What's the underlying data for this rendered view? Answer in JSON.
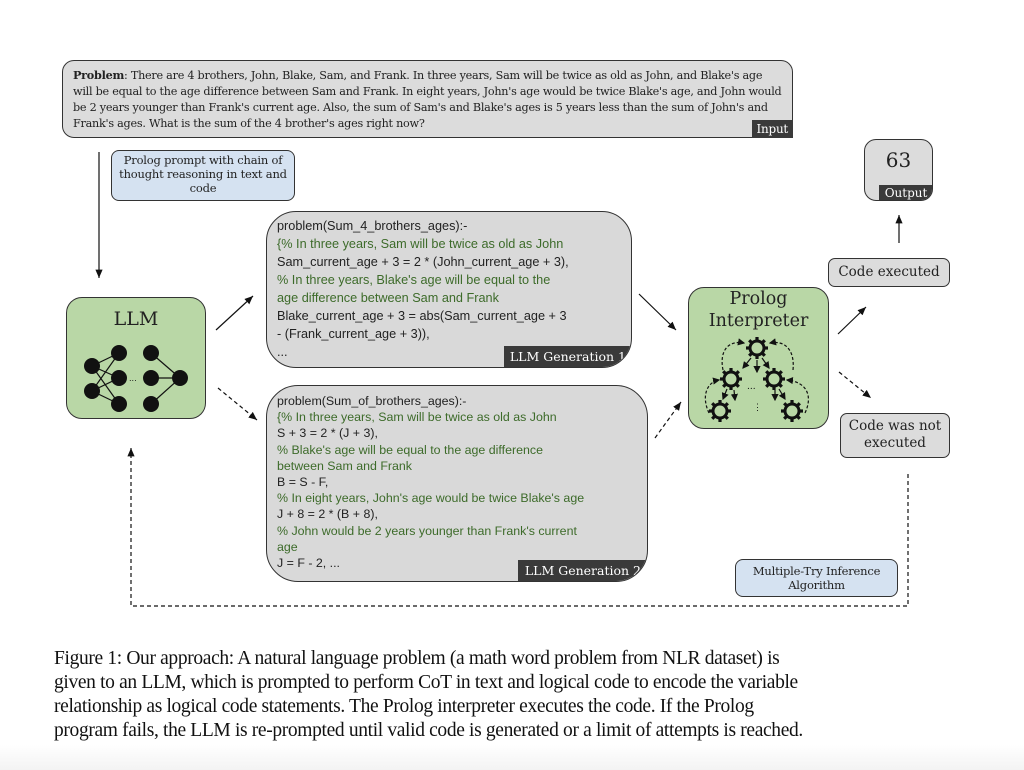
{
  "figure": {
    "input": {
      "problem_label": "Problem",
      "problem_text": ": There are 4 brothers, John, Blake, Sam, and Frank. In three years, Sam will be twice as old as John, and Blake's age will be equal to the age difference between Sam and Frank. In eight years, John's age would be twice Blake's age, and John would be 2 years younger than Frank's current age. Also, the sum of Sam's and Blake's ages is 5 years less than the sum of John's and Frank's ages. What is the sum of the 4 brother's ages right now?",
      "tag": "Input"
    },
    "prompt_box": {
      "text": "Prolog prompt with chain of thought reasoning in text and code"
    },
    "llm": {
      "title": "LLM",
      "icon": "neural-network-icon"
    },
    "generation_1": {
      "tag": "LLM Generation 1",
      "lines": [
        {
          "type": "code",
          "text": "problem(Sum_4_brothers_ages):-"
        },
        {
          "type": "comment",
          "text": "{% In three years, Sam will be twice as old as John"
        },
        {
          "type": "code",
          "text": "Sam_current_age + 3 = 2 * (John_current_age + 3),"
        },
        {
          "type": "comment",
          "text": "% In three years, Blake's age will be equal to the"
        },
        {
          "type": "comment",
          "text": "age difference between Sam and Frank"
        },
        {
          "type": "code",
          "text": "Blake_current_age + 3 = abs(Sam_current_age + 3"
        },
        {
          "type": "code",
          "text": "- (Frank_current_age + 3)),"
        },
        {
          "type": "code",
          "text": "..."
        }
      ]
    },
    "generation_2": {
      "tag": "LLM Generation 2",
      "lines": [
        {
          "type": "code",
          "text": "problem(Sum_of_brothers_ages):-"
        },
        {
          "type": "comment",
          "text": "{% In three years, Sam will be twice as old as John"
        },
        {
          "type": "code",
          "text": "S + 3 = 2 * (J + 3),"
        },
        {
          "type": "comment",
          "text": "% Blake's age will be equal to the age difference"
        },
        {
          "type": "comment",
          "text": "between Sam and Frank"
        },
        {
          "type": "code",
          "text": "B = S - F,"
        },
        {
          "type": "comment",
          "text": "% In eight years, John's age would be twice Blake's age"
        },
        {
          "type": "code",
          "text": "J + 8 = 2 * (B + 8),"
        },
        {
          "type": "comment",
          "text": "% John would be 2 years younger than Frank's current"
        },
        {
          "type": "comment",
          "text": "age"
        },
        {
          "type": "code",
          "text": "J = F - 2, ..."
        }
      ]
    },
    "interpreter": {
      "title_line1": "Prolog",
      "title_line2": "Interpreter",
      "icon": "gears-tree-icon"
    },
    "output": {
      "value": "63",
      "tag": "Output"
    },
    "code_executed": "Code executed",
    "code_not_executed": "Code was not executed",
    "multi_try": "Multiple-Try Inference Algorithm",
    "colors": {
      "green_box": "#b9d7a6",
      "blue_box": "#d5e2f1",
      "gray_box": "#d9d9d9",
      "tag_bg": "#3a3a3a",
      "comment_text": "#3d6b2a"
    }
  },
  "caption": {
    "lines": [
      "Figure 1: Our approach: A natural language problem (a math word problem from NLR dataset) is",
      "given to an LLM, which is prompted to perform CoT in text and logical code to encode the variable",
      "relationship as logical code statements.  The Prolog interpreter executes the code.  If the Prolog",
      "program fails, the LLM is re-prompted until valid code is generated or a limit of attempts is reached."
    ]
  }
}
